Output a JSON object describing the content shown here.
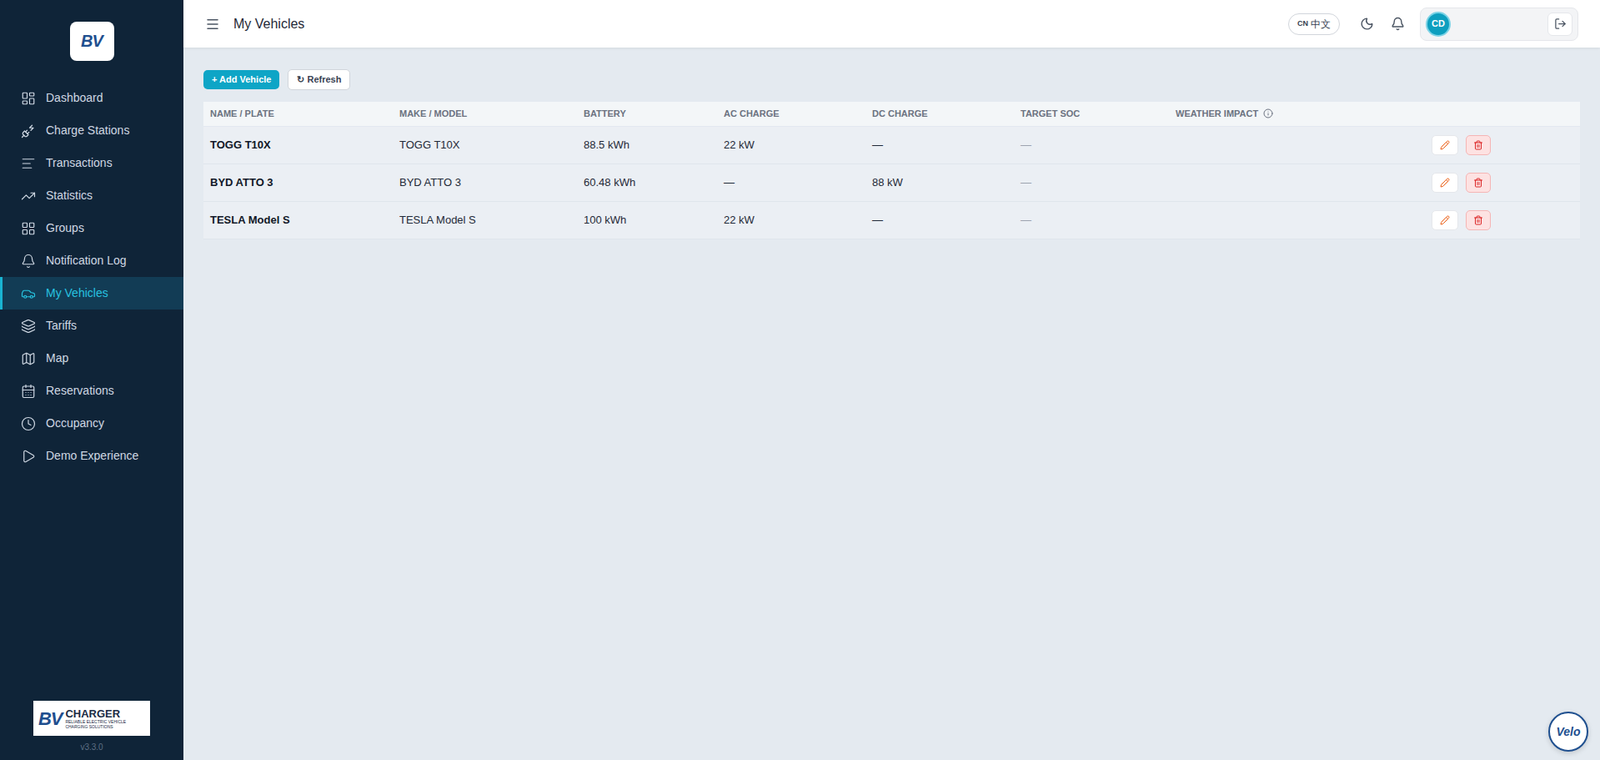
{
  "sidebar": {
    "logo": "BV",
    "items": [
      {
        "label": "Dashboard",
        "selected": false
      },
      {
        "label": "Charge Stations",
        "selected": false
      },
      {
        "label": "Transactions",
        "selected": false
      },
      {
        "label": "Statistics",
        "selected": false
      },
      {
        "label": "Groups",
        "selected": false
      },
      {
        "label": "Notification Log",
        "selected": false
      },
      {
        "label": "My Vehicles",
        "selected": true
      },
      {
        "label": "Tariffs",
        "selected": false
      },
      {
        "label": "Map",
        "selected": false
      },
      {
        "label": "Reservations",
        "selected": false
      },
      {
        "label": "Occupancy",
        "selected": false
      },
      {
        "label": "Demo Experience",
        "selected": false
      }
    ],
    "footer": {
      "logo": "BV",
      "brand": "CHARGER",
      "tagline": "RELIABLE ELECTRIC VEHICLE CHARGING SOLUTIONS",
      "version": "v3.3.0"
    }
  },
  "header": {
    "title": "My Vehicles",
    "language": {
      "code": "CN",
      "label": "中文"
    },
    "user": {
      "initials": "CD"
    }
  },
  "toolbar": {
    "buttons": [
      {
        "label": "+ Add Vehicle",
        "kind": "primary"
      },
      {
        "label": "↻ Refresh",
        "kind": "secondary"
      }
    ]
  },
  "table": {
    "columns": [
      {
        "key": "name",
        "label": "NAME / PLATE"
      },
      {
        "key": "model",
        "label": "MAKE / MODEL"
      },
      {
        "key": "battery",
        "label": "BATTERY"
      },
      {
        "key": "ac",
        "label": "AC CHARGE"
      },
      {
        "key": "dc",
        "label": "DC CHARGE"
      },
      {
        "key": "soc",
        "label": "TARGET SOC"
      },
      {
        "key": "weather",
        "label": "WEATHER IMPACT"
      }
    ],
    "rows": [
      {
        "name": "TOGG T10X",
        "model": "TOGG T10X",
        "battery": "88.5 kWh",
        "ac": "22 kW",
        "dc": "—",
        "soc": "—",
        "weather": ""
      },
      {
        "name": "BYD ATTO 3",
        "model": "BYD ATTO 3",
        "battery": "60.48 kWh",
        "ac": "—",
        "dc": "88 kW",
        "soc": "—",
        "weather": ""
      },
      {
        "name": "TESLA Model S",
        "model": "TESLA Model S",
        "battery": "100 kWh",
        "ac": "22 kW",
        "dc": "—",
        "soc": "—",
        "weather": ""
      }
    ]
  },
  "assistant": {
    "label": "Velo"
  }
}
